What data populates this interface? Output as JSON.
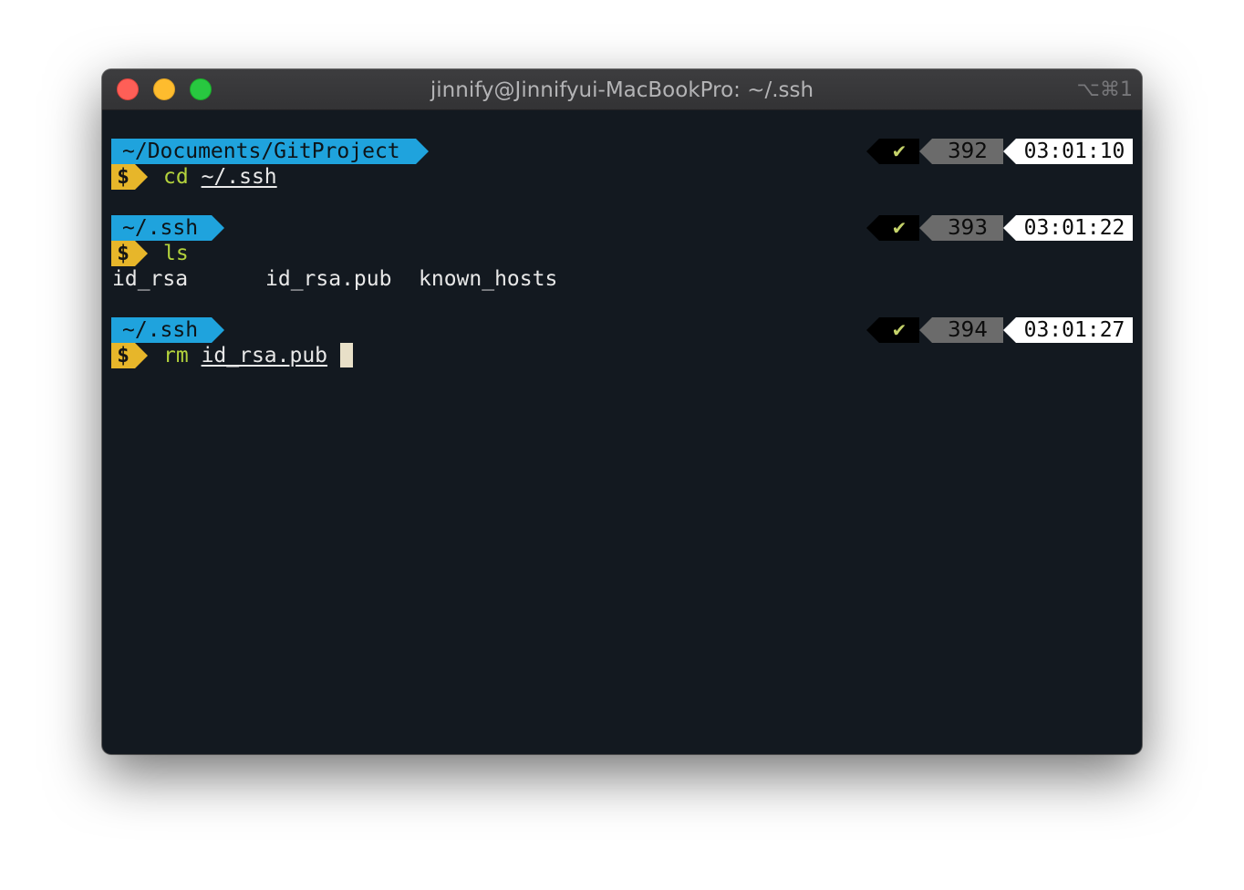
{
  "window": {
    "title": "jinnify@Jinnifyui-MacBookPro: ~/.ssh",
    "shortcut": "⌥⌘1"
  },
  "prompts": [
    {
      "dir": "~/Documents/GitProject",
      "symbol": "$",
      "command": "cd",
      "argument": "~/.ssh",
      "status": "✔",
      "history": "392",
      "time": "03:01:10"
    },
    {
      "dir": "~/.ssh",
      "symbol": "$",
      "command": "ls",
      "argument": "",
      "status": "✔",
      "history": "393",
      "time": "03:01:22"
    },
    {
      "dir": "~/.ssh",
      "symbol": "$",
      "command": "rm",
      "argument": "id_rsa.pub",
      "status": "✔",
      "history": "394",
      "time": "03:01:27"
    }
  ],
  "ls_output": [
    "id_rsa",
    "id_rsa.pub",
    "known_hosts"
  ],
  "colors": {
    "terminal_bg": "#131920",
    "dir_segment": "#1fa3dd",
    "prompt_symbol": "#e7b62a",
    "command": "#b3d23c",
    "status_ok": "#c5d36a",
    "history_segment": "#6b6b6b",
    "time_segment": "#ffffff"
  }
}
